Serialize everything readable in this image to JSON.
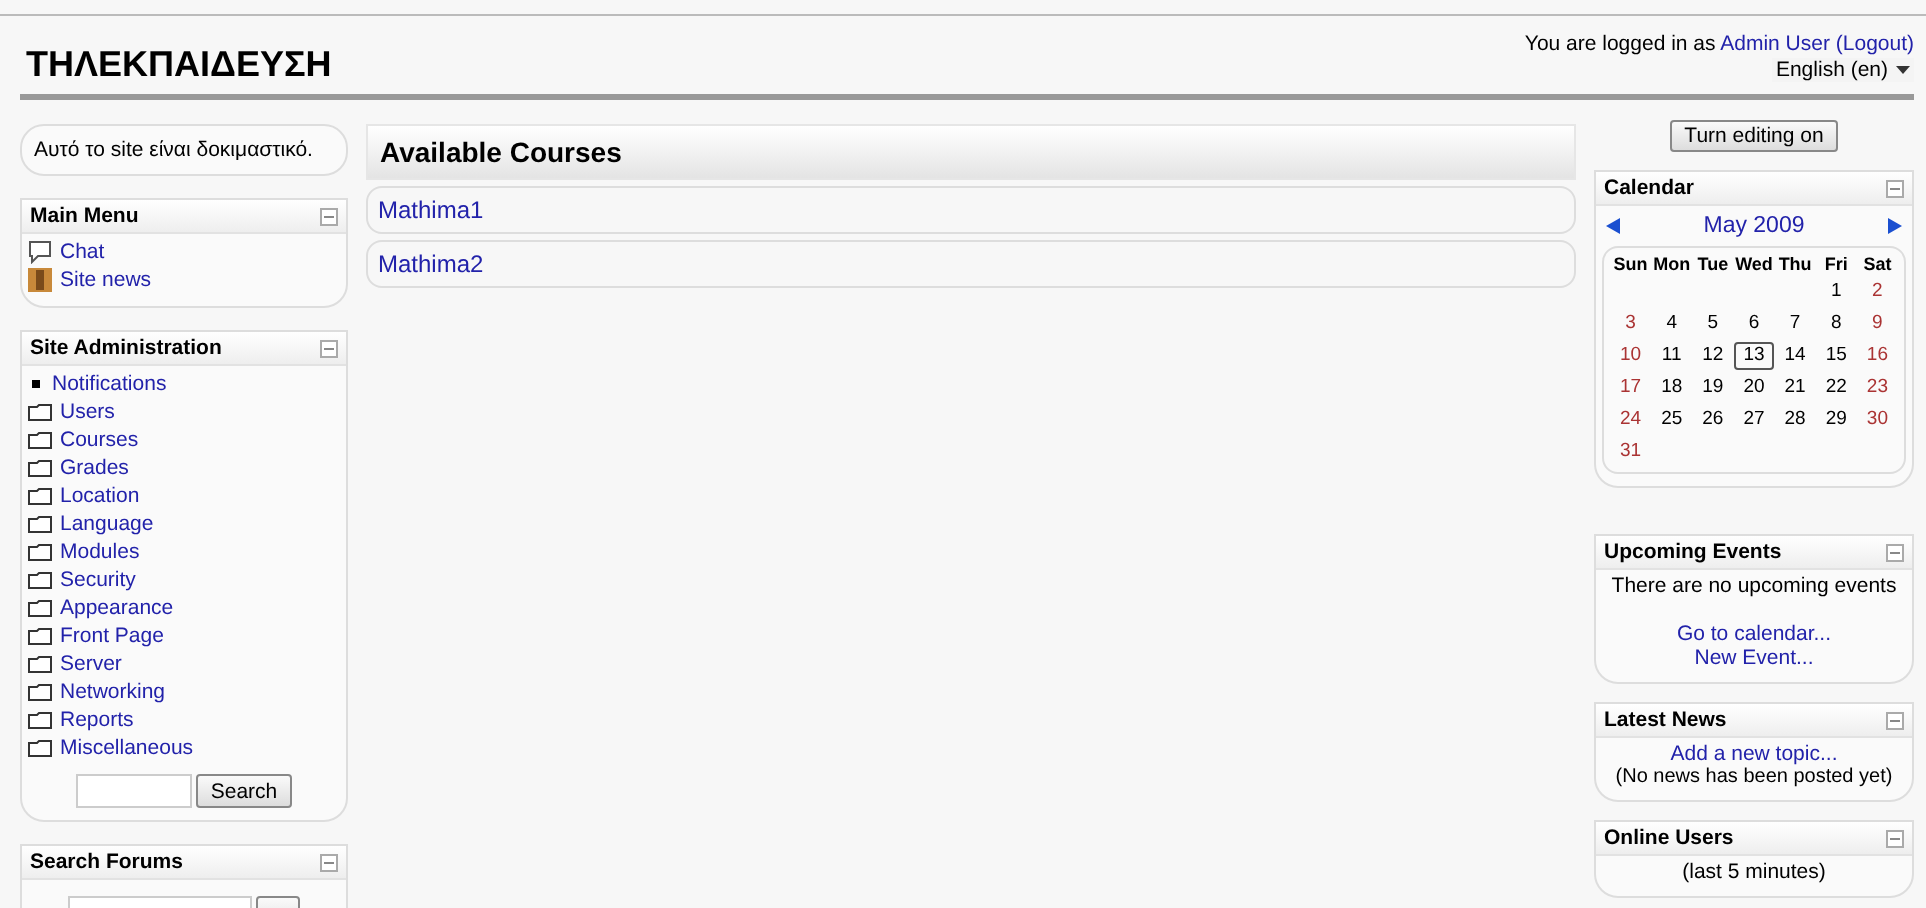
{
  "site_title": "ΤΗΛΕΚΠΑΙΔΕΥΣΗ",
  "login": {
    "prefix": "You are logged in as",
    "user": "Admin User",
    "logout": "(Logout)"
  },
  "language": "English (en)",
  "notice": "Αυτό το site είναι δοκιμαστικό.",
  "main_menu": {
    "title": "Main Menu",
    "items": [
      {
        "label": "Chat",
        "kind": "chat"
      },
      {
        "label": "Site news",
        "kind": "news"
      }
    ]
  },
  "site_admin": {
    "title": "Site Administration",
    "items": [
      {
        "label": "Notifications",
        "kind": "bullet"
      },
      {
        "label": "Users",
        "kind": "folder"
      },
      {
        "label": "Courses",
        "kind": "folder"
      },
      {
        "label": "Grades",
        "kind": "folder"
      },
      {
        "label": "Location",
        "kind": "folder"
      },
      {
        "label": "Language",
        "kind": "folder"
      },
      {
        "label": "Modules",
        "kind": "folder"
      },
      {
        "label": "Security",
        "kind": "folder"
      },
      {
        "label": "Appearance",
        "kind": "folder"
      },
      {
        "label": "Front Page",
        "kind": "folder"
      },
      {
        "label": "Server",
        "kind": "folder"
      },
      {
        "label": "Networking",
        "kind": "folder"
      },
      {
        "label": "Reports",
        "kind": "folder"
      },
      {
        "label": "Miscellaneous",
        "kind": "folder"
      }
    ],
    "search_button": "Search"
  },
  "search_forums": {
    "title": "Search Forums"
  },
  "courses": {
    "title": "Available Courses",
    "items": [
      "Mathima1",
      "Mathima2"
    ]
  },
  "editing_button": "Turn editing on",
  "calendar": {
    "title": "Calendar",
    "month": "May 2009",
    "weekdays": [
      "Sun",
      "Mon",
      "Tue",
      "Wed",
      "Thu",
      "Fri",
      "Sat"
    ],
    "weeks": [
      [
        {
          "day": "1",
          "today": false
        },
        {
          "day": "2",
          "today": false
        }
      ],
      [
        {
          "day": "3",
          "today": false
        },
        {
          "day": "4",
          "today": false
        },
        {
          "day": "5",
          "today": false
        },
        {
          "day": "6",
          "today": false
        },
        {
          "day": "7",
          "today": false
        },
        {
          "day": "8",
          "today": false
        },
        {
          "day": "9",
          "today": false
        }
      ],
      [
        {
          "day": "10",
          "today": false
        },
        {
          "day": "11",
          "today": false
        },
        {
          "day": "12",
          "today": false
        },
        {
          "day": "13",
          "today": true
        },
        {
          "day": "14",
          "today": false
        },
        {
          "day": "15",
          "today": false
        },
        {
          "day": "16",
          "today": false
        }
      ],
      [
        {
          "day": "17",
          "today": false
        },
        {
          "day": "18",
          "today": false
        },
        {
          "day": "19",
          "today": false
        },
        {
          "day": "20",
          "today": false
        },
        {
          "day": "21",
          "today": false
        },
        {
          "day": "22",
          "today": false
        },
        {
          "day": "23",
          "today": false
        }
      ],
      [
        {
          "day": "24",
          "today": false
        },
        {
          "day": "25",
          "today": false
        },
        {
          "day": "26",
          "today": false
        },
        {
          "day": "27",
          "today": false
        },
        {
          "day": "28",
          "today": false
        },
        {
          "day": "29",
          "today": false
        },
        {
          "day": "30",
          "today": false
        }
      ],
      [
        {
          "day": "31",
          "today": false
        }
      ]
    ]
  },
  "upcoming_events": {
    "title": "Upcoming Events",
    "message": "There are no upcoming events",
    "links": [
      "Go to calendar...",
      "New Event..."
    ]
  },
  "latest_news": {
    "title": "Latest News",
    "link": "Add a new topic...",
    "message": "(No news has been posted yet)"
  },
  "online_users": {
    "title": "Online Users",
    "message": "(last 5 minutes)"
  }
}
